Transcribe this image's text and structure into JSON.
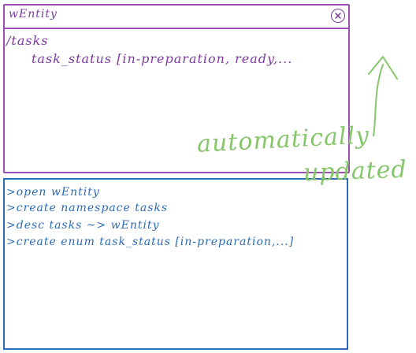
{
  "window": {
    "title": "wEntity",
    "path": "/tasks",
    "type_line": "task_status [in-preparation, ready,..."
  },
  "console": {
    "lines": [
      ">open wEntity",
      ">create namespace tasks",
      ">desc tasks  ~> wEntity",
      ">create enum task_status [in-preparation,...]"
    ]
  },
  "annotation": {
    "line1": "automatically",
    "line2": "updated"
  },
  "colors": {
    "window": "#9a4fb7",
    "console": "#2b6cb8",
    "annotation": "#86c66a"
  },
  "icons": {
    "close": "close-icon",
    "arrow": "curved-arrow-icon"
  }
}
